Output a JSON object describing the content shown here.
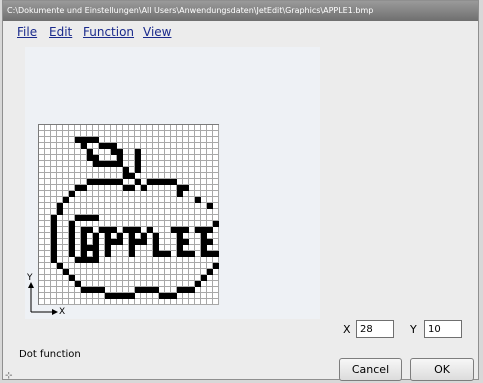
{
  "window": {
    "title": "C:\\Dokumente und Einstellungen\\All Users\\Anwendungsdaten\\JetEdit\\Graphics\\APPLE1.bmp"
  },
  "menu": {
    "items": [
      {
        "label": "File"
      },
      {
        "label": "Edit"
      },
      {
        "label": "Function"
      },
      {
        "label": "View"
      }
    ]
  },
  "canvas": {
    "axis_y": "Y",
    "axis_x": "X",
    "grid_cols": 30,
    "grid_rows": 30,
    "pixels": [
      "..............................",
      "..............................",
      "......XXXX....................",
      ".......X..XXX.................",
      "........X...XX..X.............",
      "........XX...X..X.............",
      ".........XXXXX..X.............",
      "..............X.X.............",
      "..............XX..............",
      "........XXXXXX..X.XXXXX.......",
      "......XX......XX.X.....XX.....",
      ".....X.................X......",
      "....X.....................X...",
      "...X........................X.",
      "...X..........................",
      "..X...XXXX.....................",
      "..X..X.......................X",
      "..X..X.XX.XXX.XXX.X...XXX.XXX.",
      "..X..X.X.X.X.X.X.X.X...X...X..",
      "..X..X.X.X.XXX.XXX.X...XX..XX.",
      "..X..X.XXX.X...X...X...X...X..",
      "..X..X.X.X.X...X...XXX.XXX.XXX",
      "..X...XXXX....................",
      "...X.........................X",
      "....X.......................X.",
      ".....X.....................X..",
      "......X...................X...",
      ".......XXXX.....XXXX...XXX....",
      "...........XXXXX....XXX.......",
      ".............................."
    ]
  },
  "coords": {
    "x_label": "X",
    "x_value": "28",
    "y_label": "Y",
    "y_value": "10"
  },
  "status": {
    "text": "Dot function"
  },
  "buttons": {
    "cancel": "Cancel",
    "ok": "OK"
  }
}
